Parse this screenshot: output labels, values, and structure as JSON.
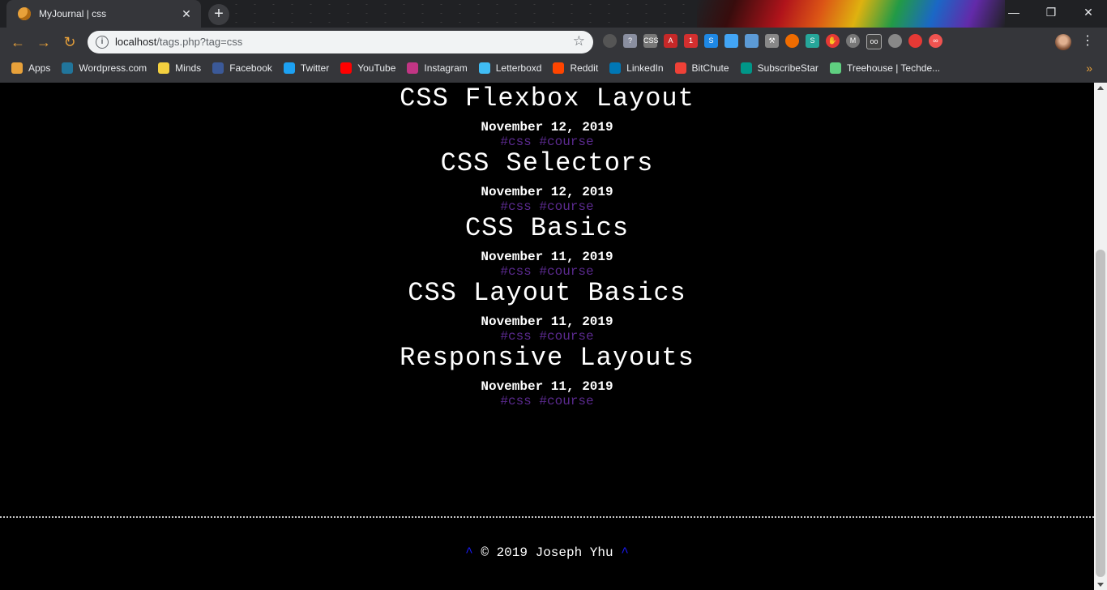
{
  "browser": {
    "tab_title": "MyJournal | css",
    "url_host": "localhost",
    "url_path": "/tags.php?tag=css",
    "new_tab_label": "+",
    "tab_close_label": "✕",
    "window_controls": {
      "minimize": "—",
      "restore": "❐",
      "close": "✕"
    },
    "menu_label": "⋮",
    "more_bookmarks_label": "»",
    "bookmarks": [
      {
        "label": "Apps",
        "icon": "apps-grid-icon",
        "color": "#e8a13a"
      },
      {
        "label": "Wordpress.com",
        "icon": "wordpress-icon",
        "color": "#21759b"
      },
      {
        "label": "Minds",
        "icon": "lightbulb-icon",
        "color": "#f4d03f"
      },
      {
        "label": "Facebook",
        "icon": "facebook-icon",
        "color": "#3b5998"
      },
      {
        "label": "Twitter",
        "icon": "twitter-icon",
        "color": "#1da1f2"
      },
      {
        "label": "YouTube",
        "icon": "youtube-icon",
        "color": "#ff0000"
      },
      {
        "label": "Instagram",
        "icon": "instagram-icon",
        "color": "#c13584"
      },
      {
        "label": "Letterboxd",
        "icon": "letterboxd-icon",
        "color": "#40bcf4"
      },
      {
        "label": "Reddit",
        "icon": "reddit-icon",
        "color": "#ff4500"
      },
      {
        "label": "LinkedIn",
        "icon": "linkedin-icon",
        "color": "#0077b5"
      },
      {
        "label": "BitChute",
        "icon": "bitchute-icon",
        "color": "#ef4137"
      },
      {
        "label": "SubscribeStar",
        "icon": "subscribestar-icon",
        "color": "#009688"
      },
      {
        "label": "Treehouse | Techde...",
        "icon": "treehouse-icon",
        "color": "#5fcf80"
      }
    ]
  },
  "posts": [
    {
      "title": "CSS Flexbox Layout",
      "date": "November 12, 2019",
      "tags": [
        "#css",
        "#course"
      ]
    },
    {
      "title": "CSS Selectors",
      "date": "November 12, 2019",
      "tags": [
        "#css",
        "#course"
      ]
    },
    {
      "title": "CSS Basics",
      "date": "November 11, 2019",
      "tags": [
        "#css",
        "#course"
      ]
    },
    {
      "title": "CSS Layout Basics",
      "date": "November 11, 2019",
      "tags": [
        "#css",
        "#course"
      ]
    },
    {
      "title": "Responsive Layouts",
      "date": "November 11, 2019",
      "tags": [
        "#css",
        "#course"
      ]
    }
  ],
  "footer": {
    "caret_left": "^",
    "text": "© 2019 Joseph Yhu",
    "caret_right": "^"
  },
  "colors": {
    "tag_link": "#5b2a8f",
    "caret": "#1a1aff",
    "accent": "#e8a13a"
  }
}
